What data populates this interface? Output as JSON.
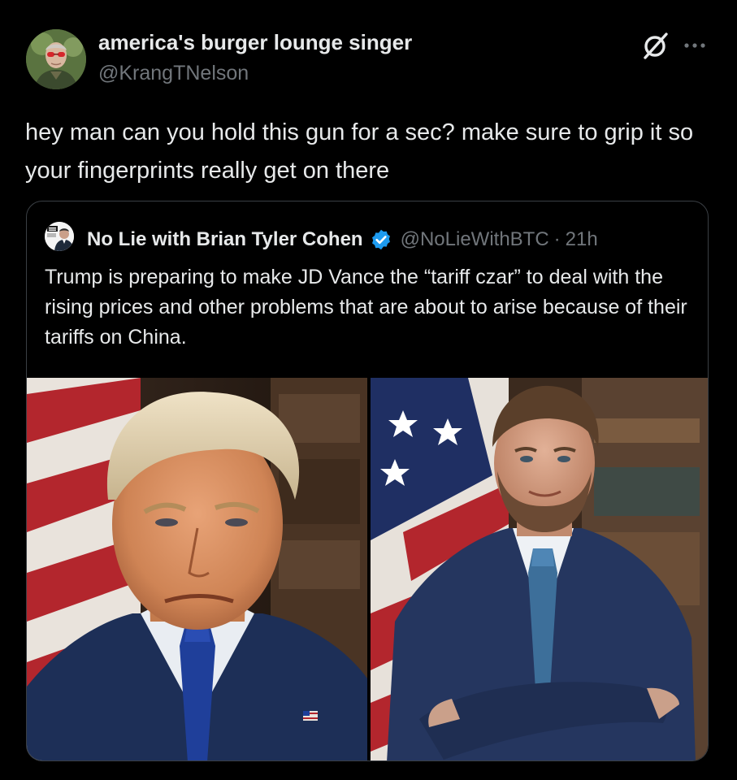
{
  "post": {
    "author": {
      "display_name": "america's burger lounge singer",
      "handle": "@KrangTNelson",
      "avatar_icon": "user-avatar"
    },
    "text": "hey man can you hold this gun for a sec? make sure to grip it so your fingerprints really get on there",
    "actions": {
      "grok_icon": "grok-icon",
      "more_icon": "more-options-icon"
    }
  },
  "quoted_post": {
    "author": {
      "display_name": "No Lie with Brian Tyler Cohen",
      "handle": "@NoLieWithBTC",
      "verified": true,
      "avatar_icon": "channel-avatar"
    },
    "separator": "·",
    "timestamp": "21h",
    "text": "Trump is preparing to make JD Vance the “tariff czar” to deal with the rising prices and other problems that are about to arise because of their tariffs on China.",
    "media": [
      {
        "type": "photo",
        "subject": "portrait-left"
      },
      {
        "type": "photo",
        "subject": "portrait-right"
      }
    ]
  },
  "colors": {
    "background": "#000000",
    "primary_text": "#e7e9ea",
    "secondary_text": "#71767b",
    "border": "#3a3f44",
    "verified_blue": "#1d9bf0"
  }
}
